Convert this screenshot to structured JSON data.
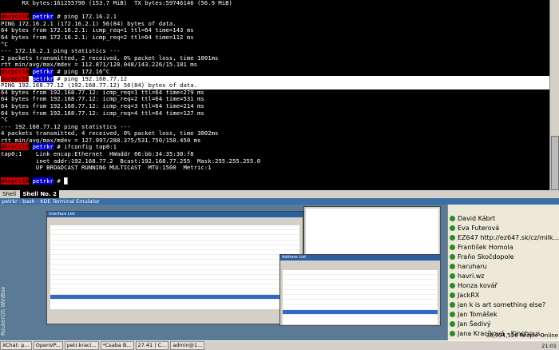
{
  "terminal": {
    "lines": [
      {
        "type": "out",
        "text": "      RX bytes:161255790 (153.7 MiB)  TX bytes:59746146 (56.9 MiB)"
      },
      {
        "type": "blank",
        "text": ""
      },
      {
        "type": "prompt",
        "host": "dhcpcc19",
        "user": "petrkr",
        "path": " # ",
        "cmd": "ping 172.16.2.1"
      },
      {
        "type": "out",
        "text": "PING 172.16.2.1 (172.16.2.1) 56(84) bytes of data."
      },
      {
        "type": "out",
        "text": "64 bytes from 172.16.2.1: icmp_req=1 ttl=64 time=143 ms"
      },
      {
        "type": "out",
        "text": "64 bytes from 172.16.2.1: icmp_req=2 ttl=64 time=112 ms"
      },
      {
        "type": "out",
        "text": "^C"
      },
      {
        "type": "out",
        "text": "--- 172.16.2.1 ping statistics ---"
      },
      {
        "type": "out",
        "text": "2 packets transmitted, 2 received, 0% packet loss, time 1001ms"
      },
      {
        "type": "out",
        "text": "rtt min/avg/max/mdev = 112.871/128.048/143.226/15.181 ms"
      },
      {
        "type": "prompt",
        "host": "dhcpcc19",
        "user": "petrkr",
        "path": " # ",
        "cmd": "ping 172.16^C"
      },
      {
        "type": "prompt",
        "host": "dhcpcc19",
        "user": "petrkr",
        "path": " # ",
        "cmd": "ping 192.168.77.12",
        "hl": true
      },
      {
        "type": "out",
        "text": "PING 192.168.77.12 (192.168.77.12) 56(84) bytes of data.",
        "hl": true
      },
      {
        "type": "out",
        "text": "64 bytes from 192.168.77.12: icmp_req=1 ttl=64 time=279 ms"
      },
      {
        "type": "out",
        "text": "64 bytes from 192.168.77.12: icmp_req=2 ttl=64 time=531 ms"
      },
      {
        "type": "out",
        "text": "64 bytes from 192.168.77.12: icmp_req=3 ttl=64 time=214 ms"
      },
      {
        "type": "out",
        "text": "64 bytes from 192.168.77.12: icmp_req=4 ttl=64 time=127 ms"
      },
      {
        "type": "out",
        "text": "^C"
      },
      {
        "type": "out",
        "text": "--- 192.168.77.12 ping statistics ---"
      },
      {
        "type": "out",
        "text": "4 packets transmitted, 4 received, 0% packet loss, time 3002ms"
      },
      {
        "type": "out",
        "text": "rtt min/avg/max/mdev = 127.997/288.375/531.750/150.450 ms"
      },
      {
        "type": "prompt",
        "host": "dhcpcc19",
        "user": "petrkr",
        "path": " # ",
        "cmd": "ifconfig tap0:1"
      },
      {
        "type": "out",
        "text": "tap0:1    Link encap:Ethernet  HWaddr 66:bb:34:35:30:f8"
      },
      {
        "type": "out",
        "text": "          inet addr:192.168.77.2  Bcast:192.168.77.255  Mask:255.255.255.0"
      },
      {
        "type": "out",
        "text": "          UP BROADCAST RUNNING MULTICAST  MTU:1500  Metric:1"
      },
      {
        "type": "blank",
        "text": ""
      },
      {
        "type": "prompt",
        "host": "dhcpcc19",
        "user": "petrkr",
        "path": " # ",
        "cmd": "█"
      }
    ]
  },
  "konsole": {
    "tabs": [
      "Shell",
      "Shell No. 2"
    ],
    "active_tab": 1,
    "title": "petrkr : bash - KDE Terminal Emulator"
  },
  "chat": {
    "contacts": [
      "David Kábrt",
      "Eva Futerová",
      "EZ647 http://ez647.sk/cz/milk...",
      "František Homola",
      "Fraňo Skočdopole",
      "haruharu",
      "havri.wz",
      "Honza kovář",
      "JackRX",
      "jan k is art something else?",
      "Jan Tomášek",
      "Jan Šedivý",
      "Jana Kracíková - Kinghous..."
    ],
    "people_online": "38,934,526 People Online"
  },
  "taskbar": {
    "items": [
      "XChat: p...",
      "OpenVP...",
      "petr.kraci...",
      "*Csaba B...",
      "27.41 | C...",
      "admin@1..."
    ],
    "clock": "21:01"
  },
  "sidebar_label": "RouterOS WinBox"
}
